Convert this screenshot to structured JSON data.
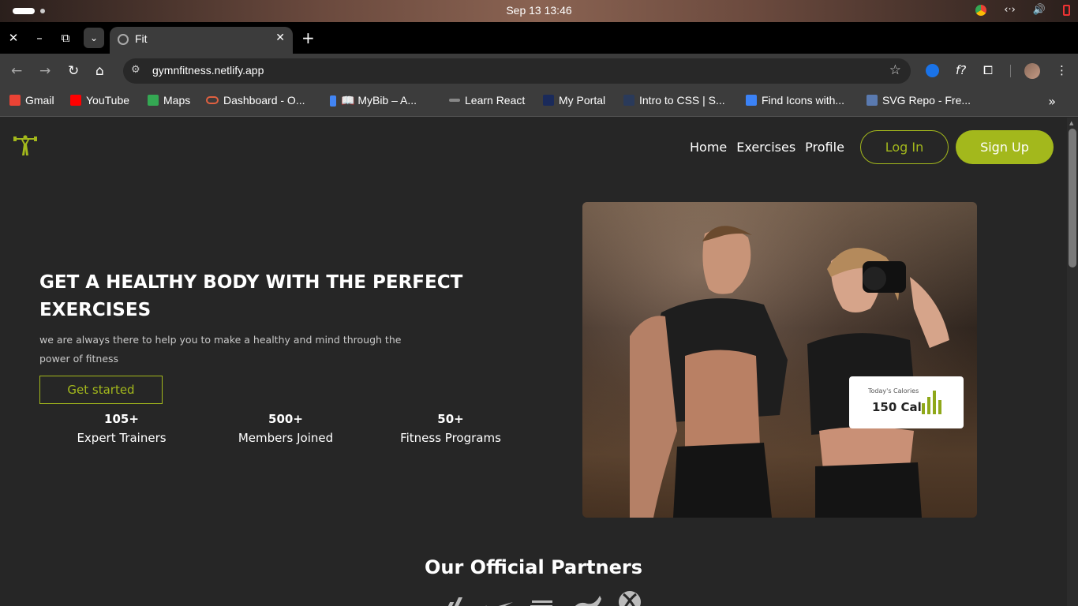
{
  "os": {
    "clock": "Sep 13  13:46"
  },
  "browser": {
    "tab_title": "Fit",
    "url": "gymnfitness.netlify.app",
    "bookmarks": [
      {
        "label": "Gmail",
        "color": "#ea4335"
      },
      {
        "label": "YouTube",
        "color": "#ff0000"
      },
      {
        "label": "Maps",
        "color": "#34a853"
      },
      {
        "label": "Dashboard - O...",
        "color": "#e06040"
      },
      {
        "label": "📖 MyBib – A...",
        "color": "#4285f4"
      },
      {
        "label": "Learn React",
        "color": "#888888"
      },
      {
        "label": "My Portal",
        "color": "#1a2a5a"
      },
      {
        "label": "Intro to CSS | S...",
        "color": "#2a3a5a"
      },
      {
        "label": "Find Icons with...",
        "color": "#3b82f6"
      },
      {
        "label": "SVG Repo - Fre...",
        "color": "#5a7ab0"
      }
    ]
  },
  "site": {
    "nav": [
      "Home",
      "Exercises",
      "Profile"
    ],
    "login_label": "Log In",
    "signup_label": "Sign Up",
    "hero": {
      "title": "GET A HEALTHY BODY WITH THE PERFECT EXERCISES",
      "subtitle": "we are always there to help you to make a healthy and mind through the power of fitness",
      "cta": "Get started"
    },
    "stats": [
      {
        "value": "105+",
        "label": "Expert Trainers"
      },
      {
        "value": "500+",
        "label": "Members Joined"
      },
      {
        "value": "50+",
        "label": "Fitness Programs"
      }
    ],
    "calories_card": {
      "label": "Today's Calories",
      "value": "150 Cal"
    },
    "partners_title": "Our Official Partners",
    "partners": [
      "adidas-logo",
      "nike-logo",
      "new-balance-logo",
      "puma-logo",
      "xbox-logo"
    ],
    "accent_color": "#a3b81c"
  }
}
